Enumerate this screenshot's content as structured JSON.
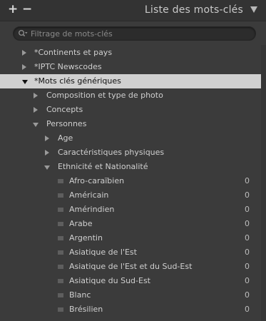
{
  "panel": {
    "title": "Liste des mots-clés",
    "add_label": "+",
    "remove_label": "−"
  },
  "search": {
    "placeholder": "Filtrage de mots-clés",
    "value": ""
  },
  "tree": {
    "root": [
      {
        "label": "*Continents et pays",
        "state": "collapsed"
      },
      {
        "label": "*IPTC Newscodes",
        "state": "collapsed"
      },
      {
        "label": "*Mots clés génériques",
        "state": "expanded",
        "selected": true
      }
    ],
    "generic": [
      {
        "label": "Composition et type de photo",
        "state": "collapsed"
      },
      {
        "label": "Concepts",
        "state": "collapsed"
      },
      {
        "label": "Personnes",
        "state": "expanded"
      }
    ],
    "people": [
      {
        "label": "Age",
        "state": "collapsed"
      },
      {
        "label": "Caractéristiques physiques",
        "state": "collapsed"
      },
      {
        "label": "Ethnicité et Nationalité",
        "state": "expanded"
      }
    ],
    "ethnicity": [
      {
        "label": "Afro-caraïbien",
        "count": "0"
      },
      {
        "label": "Américain",
        "count": "0"
      },
      {
        "label": "Amérindien",
        "count": "0"
      },
      {
        "label": "Arabe",
        "count": "0"
      },
      {
        "label": "Argentin",
        "count": "0"
      },
      {
        "label": "Asiatique de l'Est",
        "count": "0"
      },
      {
        "label": "Asiatique de l'Est et du Sud-Est",
        "count": "0"
      },
      {
        "label": "Asiatique du Sud-Est",
        "count": "0"
      },
      {
        "label": "Blanc",
        "count": "0"
      },
      {
        "label": "Brésilien",
        "count": "0"
      }
    ]
  }
}
